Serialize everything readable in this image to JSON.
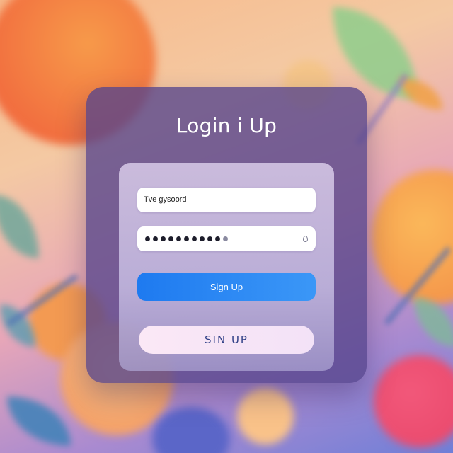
{
  "card": {
    "title": "Login i Up"
  },
  "form": {
    "username_value": "Tve gysoord",
    "password_mask_count": 11,
    "primary_button_label": "Sign Up",
    "secondary_button_label": "SIN UP"
  },
  "icons": {
    "password_toggle": "eye-icon"
  },
  "colors": {
    "primary_button": "#1e7af0",
    "secondary_button": "#fbe8f6",
    "card": "#54448c"
  }
}
